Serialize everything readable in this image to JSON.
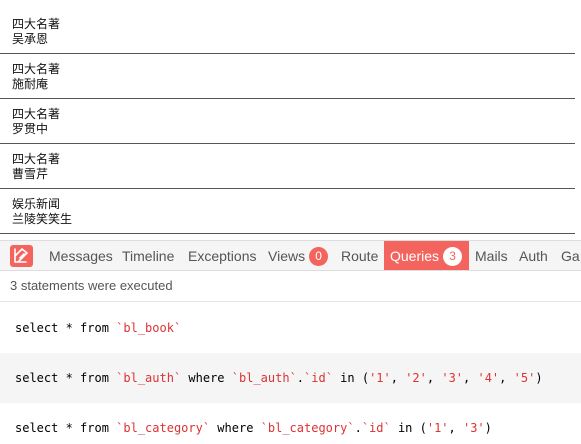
{
  "books": [
    {
      "category": "四大名著",
      "author": "吴承恩"
    },
    {
      "category": "四大名著",
      "author": "施耐庵"
    },
    {
      "category": "四大名著",
      "author": "罗贯中"
    },
    {
      "category": "四大名著",
      "author": "曹雪芹"
    },
    {
      "category": "娱乐新闻",
      "author": "兰陵笑笑生"
    }
  ],
  "debugbar": {
    "tabs": [
      {
        "label": "Messages"
      },
      {
        "label": "Timeline"
      },
      {
        "label": "Exceptions"
      },
      {
        "label": "Views",
        "badge": "0"
      },
      {
        "label": "Route"
      },
      {
        "label": "Queries",
        "badge": "3",
        "active": true
      },
      {
        "label": "Mails"
      },
      {
        "label": "Auth"
      },
      {
        "label": "Ga"
      }
    ],
    "summary": "3 statements were executed",
    "statements": [
      {
        "parts": [
          {
            "t": "select * from ",
            "c": "kw"
          },
          {
            "t": "`bl_book`",
            "c": "str"
          }
        ]
      },
      {
        "parts": [
          {
            "t": "select * from ",
            "c": "kw"
          },
          {
            "t": "`bl_auth`",
            "c": "str"
          },
          {
            "t": " where ",
            "c": "kw"
          },
          {
            "t": "`bl_auth`",
            "c": "str"
          },
          {
            "t": ".",
            "c": "kw"
          },
          {
            "t": "`id`",
            "c": "str"
          },
          {
            "t": " in (",
            "c": "kw"
          },
          {
            "t": "'1'",
            "c": "str"
          },
          {
            "t": ", ",
            "c": "kw"
          },
          {
            "t": "'2'",
            "c": "str"
          },
          {
            "t": ", ",
            "c": "kw"
          },
          {
            "t": "'3'",
            "c": "str"
          },
          {
            "t": ", ",
            "c": "kw"
          },
          {
            "t": "'4'",
            "c": "str"
          },
          {
            "t": ", ",
            "c": "kw"
          },
          {
            "t": "'5'",
            "c": "str"
          },
          {
            "t": ")",
            "c": "kw"
          }
        ]
      },
      {
        "parts": [
          {
            "t": "select * from ",
            "c": "kw"
          },
          {
            "t": "`bl_category`",
            "c": "str"
          },
          {
            "t": " where ",
            "c": "kw"
          },
          {
            "t": "`bl_category`",
            "c": "str"
          },
          {
            "t": ".",
            "c": "kw"
          },
          {
            "t": "`id`",
            "c": "str"
          },
          {
            "t": " in (",
            "c": "kw"
          },
          {
            "t": "'1'",
            "c": "str"
          },
          {
            "t": ", ",
            "c": "kw"
          },
          {
            "t": "'3'",
            "c": "str"
          },
          {
            "t": ")",
            "c": "kw"
          }
        ]
      }
    ]
  },
  "colors": {
    "accent": "#f4645f",
    "string": "#dd3333"
  },
  "icons": {
    "brand": "laravel-debugbar-logo-icon"
  }
}
